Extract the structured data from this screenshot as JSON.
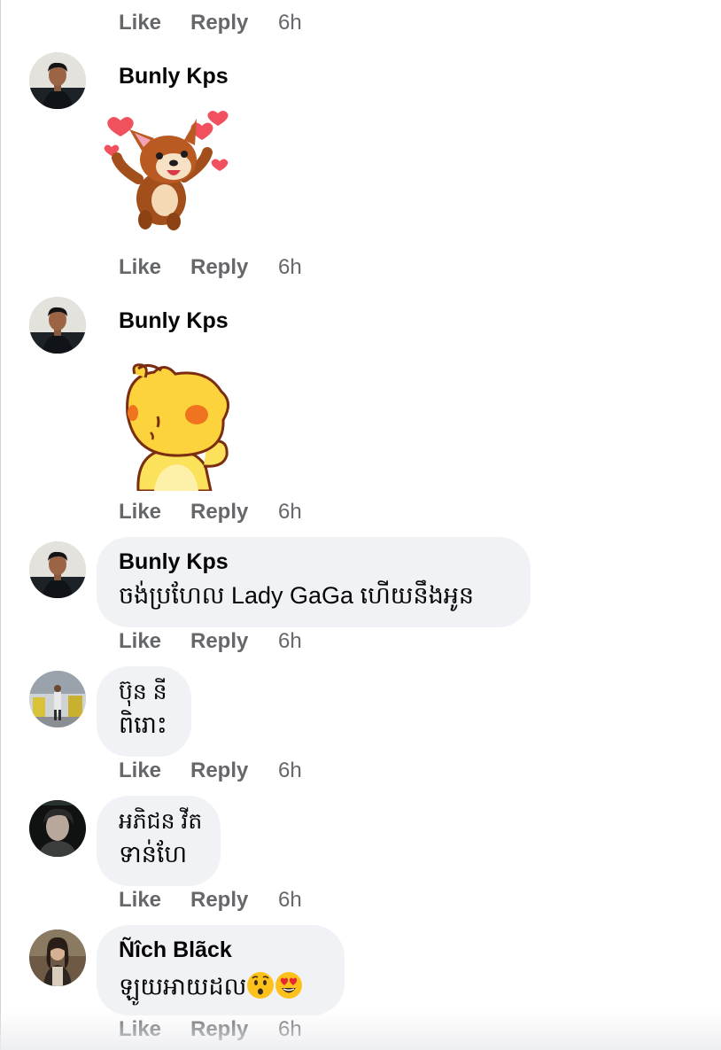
{
  "top_actions": {
    "like": "Like",
    "reply": "Reply",
    "time": "6h"
  },
  "comments": [
    {
      "author": "Bunly Kps",
      "type": "sticker",
      "sticker": "corgi-hearts-sticker",
      "actions": {
        "like": "Like",
        "reply": "Reply",
        "time": "6h"
      }
    },
    {
      "author": "Bunly Kps",
      "type": "sticker",
      "sticker": "yellow-chick-sticker",
      "actions": {
        "like": "Like",
        "reply": "Reply",
        "time": "6h"
      }
    },
    {
      "author": "Bunly Kps",
      "type": "text",
      "lines": [
        "ចង់ប្រហែល Lady GaGa ហើយនឹងអូន"
      ],
      "actions": {
        "like": "Like",
        "reply": "Reply",
        "time": "6h"
      }
    },
    {
      "author": "ប៊ុន នី",
      "type": "text",
      "lines": [
        "ពិរោះ"
      ],
      "actions": {
        "like": "Like",
        "reply": "Reply",
        "time": "6h"
      }
    },
    {
      "author": "អភិជន វីត",
      "type": "text",
      "lines": [
        "ទាន់ហែ"
      ],
      "actions": {
        "like": "Like",
        "reply": "Reply",
        "time": "6h"
      }
    },
    {
      "author": "Ñîch Blãck",
      "type": "text",
      "lines": [
        "ឡូយអាយដល"
      ],
      "emojis": [
        "hushed-face-emoji",
        "heart-eyes-emoji"
      ],
      "actions": {
        "like": "Like",
        "reply": "Reply",
        "time": "6h"
      }
    }
  ]
}
